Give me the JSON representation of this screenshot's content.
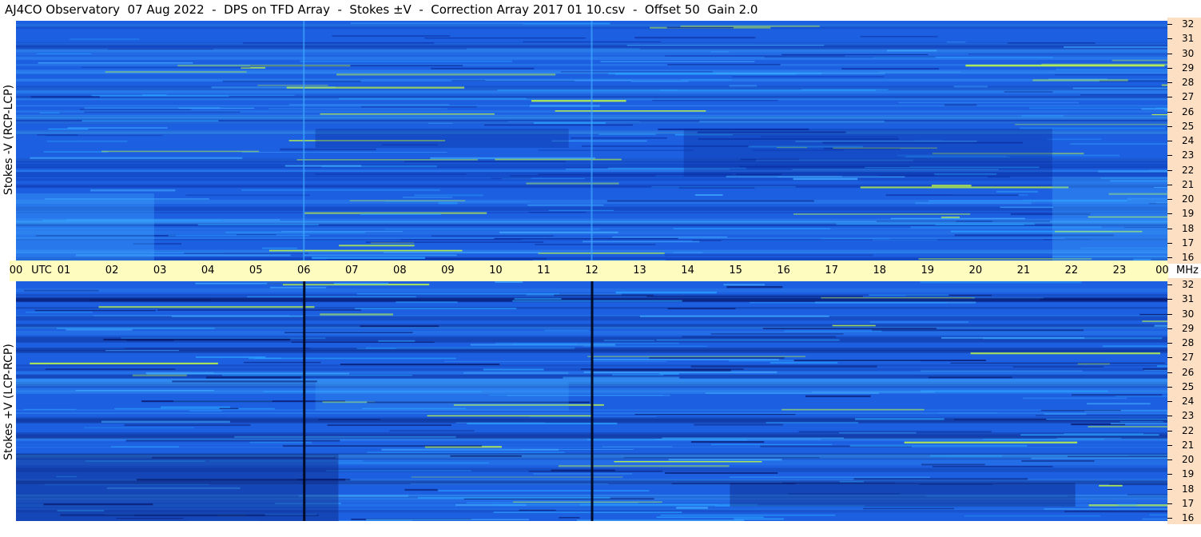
{
  "title": "AJ4CO Observatory  07 Aug 2022  -  DPS on TFD Array  -  Stokes ±V  -  Correction Array 2017 01 10.csv  -  Offset 50  Gain 2.0",
  "chart_data": [
    {
      "type": "heatmap",
      "panel": "top",
      "ylabel": "Stokes -V (RCP-LCP)",
      "y_ticks": [
        "32",
        "31",
        "30",
        "29",
        "28",
        "27",
        "26",
        "25",
        "24",
        "23",
        "22",
        "21",
        "20",
        "19",
        "18",
        "17",
        "16"
      ],
      "ylim": [
        16,
        32
      ],
      "x_ticks": [
        "00",
        "01",
        "02",
        "03",
        "04",
        "05",
        "06",
        "07",
        "08",
        "09",
        "10",
        "11",
        "12",
        "13",
        "14",
        "15",
        "16",
        "17",
        "18",
        "19",
        "20",
        "21",
        "22",
        "23",
        "00"
      ],
      "xlim": [
        0,
        24
      ],
      "colors": {
        "base": "#1c5fe0",
        "bright": "#3fa8ff",
        "dark": "#0a2a9c",
        "hot": "#c8ff40",
        "band": "#2aa0ff"
      },
      "vertical_marks_utc": [
        6,
        12
      ]
    },
    {
      "type": "heatmap",
      "panel": "bottom",
      "ylabel": "Stokes +V (LCP-RCP)",
      "y_ticks": [
        "32",
        "31",
        "30",
        "29",
        "28",
        "27",
        "26",
        "25",
        "24",
        "23",
        "22",
        "21",
        "20",
        "19",
        "18",
        "17",
        "16"
      ],
      "ylim": [
        16,
        32
      ],
      "x_ticks": [
        "00",
        "01",
        "02",
        "03",
        "04",
        "05",
        "06",
        "07",
        "08",
        "09",
        "10",
        "11",
        "12",
        "13",
        "14",
        "15",
        "16",
        "17",
        "18",
        "19",
        "20",
        "21",
        "22",
        "23",
        "00"
      ],
      "xlim": [
        0,
        24
      ],
      "colors": {
        "base": "#1c5fe0",
        "bright": "#3fa8ff",
        "dark": "#08196e",
        "hot": "#c8ff40",
        "band": "#2aa0ff"
      },
      "vertical_marks_utc": [
        6,
        12
      ]
    }
  ],
  "time_axis": {
    "unit_label": "UTC",
    "freq_unit": "MHz"
  }
}
